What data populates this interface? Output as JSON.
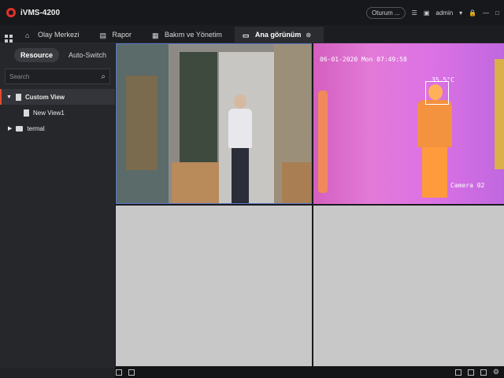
{
  "app": {
    "title": "iVMS-4200"
  },
  "topbar": {
    "login_label": "Oturum ...",
    "user": "admin"
  },
  "tabs": [
    {
      "label": "Olay Merkezi"
    },
    {
      "label": "Rapor"
    },
    {
      "label": "Bakım ve Yönetim"
    },
    {
      "label": "Ana görünüm"
    }
  ],
  "sidebar": {
    "segments": [
      "Resource",
      "Auto-Switch"
    ],
    "search_placeholder": "Search",
    "tree": [
      {
        "label": "Custom View"
      },
      {
        "label": "New View1"
      },
      {
        "label": "termal"
      }
    ]
  },
  "video": {
    "thermal": {
      "timestamp": "06-01-2020 Mon 07:49:58",
      "temp": "35.5°C",
      "camera": "Camera 02"
    }
  },
  "colors": {
    "accent": "#e24a2f",
    "selection_border": "#5a78c8"
  }
}
